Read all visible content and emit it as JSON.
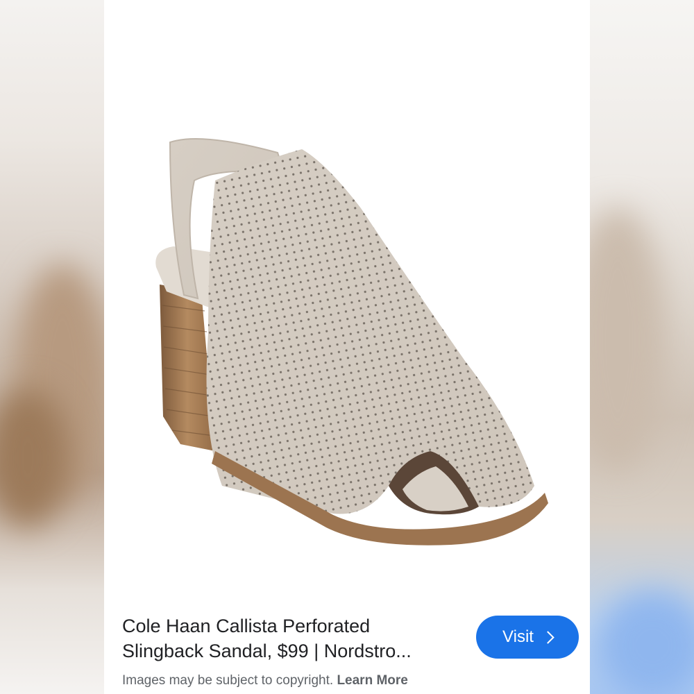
{
  "result": {
    "title_line1": "Cole Haan Callista Perforated",
    "title_line2": "Slingback Sandal, $99 | Nordstro...",
    "visit_label": "Visit",
    "copyright_note": "Images may be subject to copyright.",
    "learn_more_label": "Learn More"
  },
  "colors": {
    "visit_button": "#1a73e8",
    "title_text": "#202124",
    "note_text": "#5f6368",
    "shoe_suede": "#d9d2c9",
    "heel_wood": "#a47a52"
  },
  "image": {
    "subject": "shoe-image"
  }
}
